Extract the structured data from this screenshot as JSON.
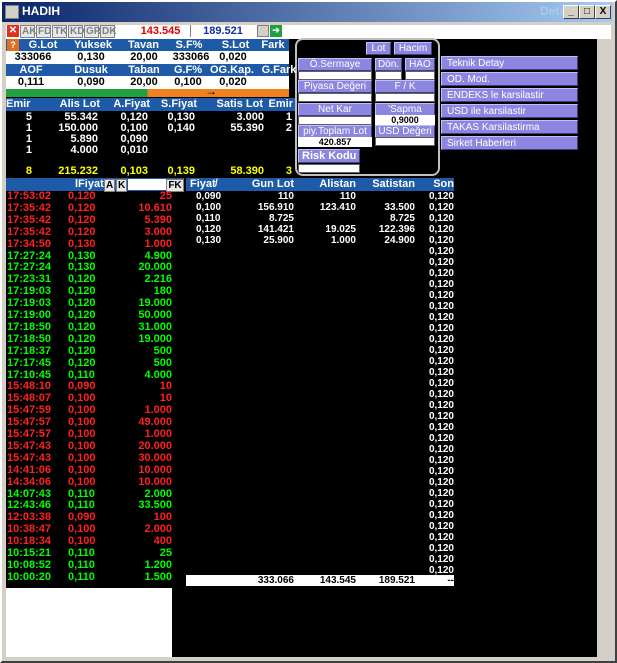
{
  "window": {
    "title": "HADIH",
    "right_title": "Detay",
    "min": "_",
    "max": "□",
    "close": "X"
  },
  "toolbar": {
    "chips": [
      "AK",
      "FD",
      "TK",
      "KD",
      "GR",
      "DK"
    ],
    "v1": "143.545",
    "v2": "189.521"
  },
  "summary": {
    "h1": [
      "G.Lot",
      "Yuksek",
      "Tavan",
      "S.F%",
      "S.Lot",
      "Fark"
    ],
    "v1": [
      "333066",
      "0,130",
      "20,00",
      "333066",
      "0,020"
    ],
    "h2": [
      "AOF",
      "Dusuk",
      "Taban",
      "G.F%",
      "OG.Kap.",
      "G.Fark"
    ],
    "v2": [
      "0,111",
      "0,090",
      "20,00",
      "0,100",
      "0,020"
    ]
  },
  "depth": {
    "headers": [
      "Emir",
      "Alis Lot",
      "A.Fiyat",
      "S.Fiyat",
      "Satis Lot",
      "Emir"
    ],
    "rows": [
      [
        "5",
        "55.342",
        "0,120",
        "0,130",
        "3.000",
        "1"
      ],
      [
        "1",
        "150.000",
        "0,100",
        "0,140",
        "55.390",
        "2"
      ],
      [
        "1",
        "5.890",
        "0,090",
        "",
        "",
        ""
      ],
      [
        "1",
        "4.000",
        "0,010",
        "",
        "",
        ""
      ]
    ],
    "total": [
      "8",
      "215.232",
      "0,103",
      "0,139",
      "58.390",
      "3"
    ]
  },
  "info": {
    "lot": "Lot",
    "hacim": "Hacim",
    "osermaye": "Ö.Sermaye",
    "don": "Dön.",
    "hao": "HAO",
    "piyasa": "Piyasa Değeri",
    "fk": "F / K",
    "netkar": "Net Kar",
    "sapma": "'Sapma",
    "sapma_val": "0,9000",
    "piy_toplam": "piy.Toplam Lot",
    "piy_val": "420.857",
    "usd": "USD Değeri",
    "risk": "Risk Kodu"
  },
  "side": [
    "Teknik Detay",
    "OD. Mod.",
    "ENDEKS le karsilastir",
    "USD ile karsilastir",
    "TAKAS Karsilastirma",
    "Sirket Haberleri"
  ],
  "trades": {
    "headers": [
      "lFiyat",
      "A",
      "K",
      "FK"
    ],
    "rows": [
      [
        "17:53:02",
        "0,120",
        "25",
        "r"
      ],
      [
        "17:35:42",
        "0,120",
        "10.610",
        "r"
      ],
      [
        "17:35:42",
        "0,120",
        "5.390",
        "r"
      ],
      [
        "17:35:42",
        "0,120",
        "3.000",
        "r"
      ],
      [
        "17:34:50",
        "0,130",
        "1.000",
        "r"
      ],
      [
        "17:27:24",
        "0,130",
        "4.900",
        "g"
      ],
      [
        "17:27:24",
        "0,130",
        "20.000",
        "g"
      ],
      [
        "17:23:31",
        "0,120",
        "2.216",
        "g"
      ],
      [
        "17:19:03",
        "0,120",
        "180",
        "g"
      ],
      [
        "17:19:03",
        "0,120",
        "19.000",
        "g"
      ],
      [
        "17:19:00",
        "0,120",
        "50.000",
        "g"
      ],
      [
        "17:18:50",
        "0,120",
        "31.000",
        "g"
      ],
      [
        "17:18:50",
        "0,120",
        "19.000",
        "g"
      ],
      [
        "17:18:37",
        "0,120",
        "500",
        "g"
      ],
      [
        "17:17:45",
        "0,120",
        "500",
        "g"
      ],
      [
        "17:10:45",
        "0,110",
        "4.000",
        "g"
      ],
      [
        "15:48:10",
        "0,090",
        "10",
        "r"
      ],
      [
        "15:48:07",
        "0,100",
        "10",
        "r"
      ],
      [
        "15:47:59",
        "0,100",
        "1.000",
        "r"
      ],
      [
        "15:47:57",
        "0,100",
        "49.000",
        "r"
      ],
      [
        "15:47:57",
        "0,100",
        "1.000",
        "r"
      ],
      [
        "15:47:43",
        "0,100",
        "20.000",
        "r"
      ],
      [
        "15:47:43",
        "0,100",
        "30.000",
        "r"
      ],
      [
        "14:41:06",
        "0,100",
        "10.000",
        "r"
      ],
      [
        "14:34:06",
        "0,100",
        "10.000",
        "r"
      ],
      [
        "14:07:43",
        "0,110",
        "2.000",
        "g"
      ],
      [
        "12:43:46",
        "0,110",
        "33.500",
        "g"
      ],
      [
        "12:03:38",
        "0,090",
        "100",
        "r"
      ],
      [
        "10:38:47",
        "0,100",
        "2.000",
        "r"
      ],
      [
        "10:18:34",
        "0,100",
        "400",
        "r"
      ],
      [
        "10:15:21",
        "0,110",
        "25",
        "g"
      ],
      [
        "10:08:52",
        "0,110",
        "1.200",
        "g"
      ],
      [
        "10:00:20",
        "0,110",
        "1.500",
        "g"
      ]
    ]
  },
  "dist": {
    "headers": [
      "Fiyat",
      "Gun Lot",
      "Alistan",
      "Satistan",
      "Son"
    ],
    "rows": [
      [
        "0,090",
        "110",
        "110",
        "",
        ""
      ],
      [
        "0,100",
        "156.910",
        "123.410",
        "33.500",
        ""
      ],
      [
        "0,110",
        "8.725",
        "",
        "8.725",
        ""
      ],
      [
        "0,120",
        "141.421",
        "19.025",
        "122.396",
        ""
      ],
      [
        "0,130",
        "25.900",
        "1.000",
        "24.900",
        ""
      ]
    ],
    "son": "0,120",
    "son_count": 35,
    "totals": [
      "333.066",
      "143.545",
      "189.521",
      "--"
    ]
  }
}
